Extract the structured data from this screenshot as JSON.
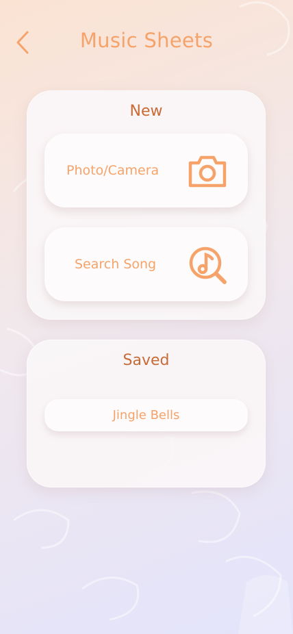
{
  "header": {
    "title": "Music Sheets",
    "back_icon": "chevron-left-icon"
  },
  "new_section": {
    "title": "New",
    "actions": [
      {
        "label": "Photo/Camera",
        "icon": "camera-icon"
      },
      {
        "label": "Search Song",
        "icon": "music-search-icon"
      }
    ]
  },
  "saved_section": {
    "title": "Saved",
    "items": [
      {
        "label": "Jingle Bells"
      }
    ]
  },
  "colors": {
    "accent": "#f5a36a",
    "heading": "#c86a35",
    "card": "#faf6f7"
  }
}
